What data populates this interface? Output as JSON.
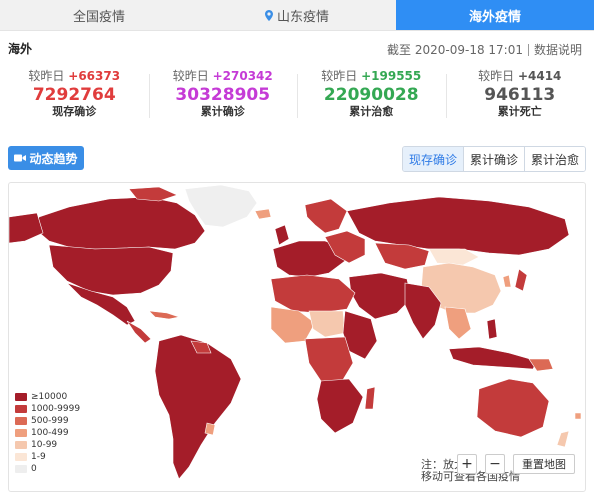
{
  "tabs": [
    {
      "label": "全国疫情"
    },
    {
      "label": "山东疫情"
    },
    {
      "label": "海外疫情"
    }
  ],
  "header": {
    "region": "海外",
    "updated": "截至 2020-09-18 17:01",
    "help": "数据说明"
  },
  "stats": [
    {
      "delta_prefix": "较昨日",
      "delta": "+66373",
      "value": "7292764",
      "label": "现存确诊",
      "color": "#e03c3c"
    },
    {
      "delta_prefix": "较昨日",
      "delta": "+270342",
      "value": "30328905",
      "label": "累计确诊",
      "color": "#c53bd6"
    },
    {
      "delta_prefix": "较昨日",
      "delta": "+199555",
      "value": "22090028",
      "label": "累计治愈",
      "color": "#34a853"
    },
    {
      "delta_prefix": "较昨日",
      "delta": "+4414",
      "value": "946113",
      "label": "累计死亡",
      "color": "#555555"
    }
  ],
  "controls": {
    "trend_label": "动态趋势",
    "view_options": [
      "现存确诊",
      "累计确诊",
      "累计治愈"
    ],
    "active_view": "现存确诊"
  },
  "map": {
    "legend": [
      {
        "label": "≥10000",
        "color": "#a41d29"
      },
      {
        "label": "1000-9999",
        "color": "#c33b3b"
      },
      {
        "label": "500-999",
        "color": "#dc6a55"
      },
      {
        "label": "100-499",
        "color": "#ef9f7e"
      },
      {
        "label": "10-99",
        "color": "#f5c8ae"
      },
      {
        "label": "1-9",
        "color": "#fbe6d6"
      },
      {
        "label": "0",
        "color": "#eeeeee"
      }
    ],
    "hint_line1": "注：放大",
    "hint_line2": "移动可查看各国疫情",
    "zoom_in": "+",
    "zoom_out": "−",
    "reset_label": "重置地图"
  }
}
